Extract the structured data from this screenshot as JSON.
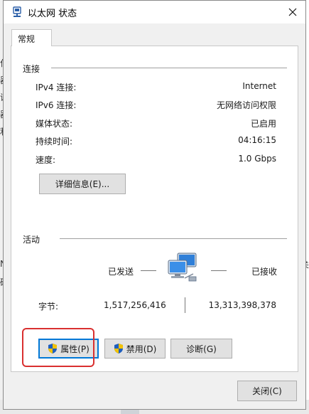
{
  "window": {
    "title": "以太网 状态"
  },
  "tabs": [
    {
      "label": "常规"
    }
  ],
  "connection": {
    "section_label": "连接",
    "rows": [
      {
        "label": "IPv4 连接:",
        "value": "Internet"
      },
      {
        "label": "IPv6 连接:",
        "value": "无网络访问权限"
      },
      {
        "label": "媒体状态:",
        "value": "已启用"
      },
      {
        "label": "持续时间:",
        "value": "04:16:15"
      },
      {
        "label": "速度:",
        "value": "1.0 Gbps"
      }
    ],
    "details_button": "详细信息(E)..."
  },
  "activity": {
    "section_label": "活动",
    "sent_label": "已发送",
    "received_label": "已接收",
    "bytes_label": "字节:",
    "bytes_sent": "1,517,256,416",
    "bytes_received": "13,313,398,378"
  },
  "buttons": {
    "properties": "属性(P)",
    "disable": "禁用(D)",
    "diagnose": "诊断(G)",
    "close": "关闭(C)"
  },
  "background": {
    "left_chars": [
      "作",
      "器",
      "议",
      "器",
      "利"
    ],
    "left_mid": "N",
    "left_mid2": "确",
    "right_mid": "介关"
  },
  "colors": {
    "focus": "#0078d7",
    "highlight": "#d93030",
    "shield_blue": "#1f5fbf",
    "shield_yellow": "#f2c200"
  },
  "icons": [
    "ethernet-icon",
    "close-icon",
    "shield-icon",
    "network-computers-icon"
  ]
}
